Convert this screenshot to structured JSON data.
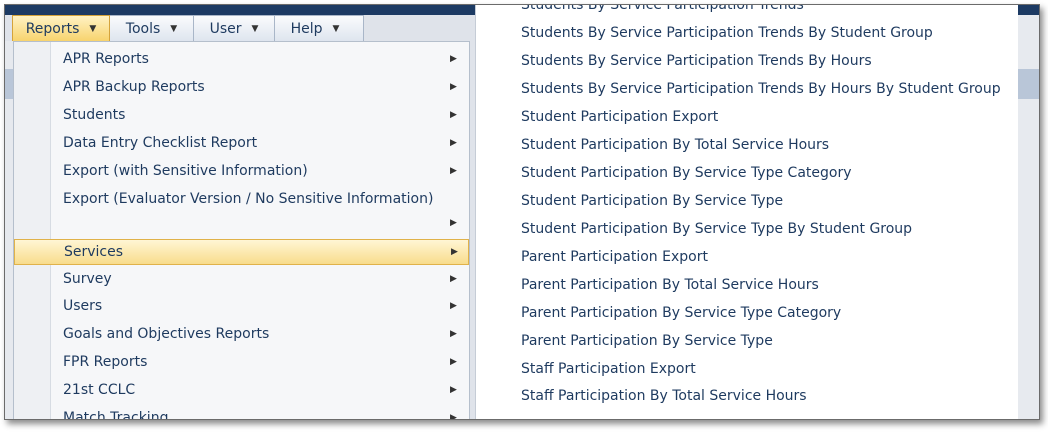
{
  "menubar": {
    "items": [
      "Reports",
      "Tools",
      "User",
      "Help"
    ]
  },
  "reports_menu": {
    "items": [
      "APR Reports",
      "APR Backup Reports",
      "Students",
      "Data Entry Checklist Report",
      "Export (with Sensitive Information)",
      "Export (Evaluator Version / No Sensitive Information)",
      "",
      "Services",
      "Survey",
      "Users",
      "Goals and Objectives Reports",
      "FPR Reports",
      "21st CCLC",
      "Match Tracking"
    ],
    "highlighted": "Services"
  },
  "services_submenu": {
    "items": [
      "Students By Service Participation Trends",
      "Students By Service Participation Trends By Student Group",
      "Students By Service Participation Trends By Hours",
      "Students By Service Participation Trends By Hours By Student Group",
      "Student Participation Export",
      "Student Participation By Total Service Hours",
      "Student Participation By Service Type Category",
      "Student Participation By Service Type",
      "Student Participation By Service Type By Student Group",
      "Parent Participation Export",
      "Parent Participation By Total Service Hours",
      "Parent Participation By Service Type Category",
      "Parent Participation By Service Type",
      "Staff Participation Export",
      "Staff Participation By Total Service Hours"
    ]
  },
  "icons": {
    "caret": "chevron-down-icon",
    "arrow": "chevron-right-icon"
  },
  "colors": {
    "highlight": "#f8dc8c",
    "text": "#1e3a5f",
    "header": "#1c3a63"
  }
}
